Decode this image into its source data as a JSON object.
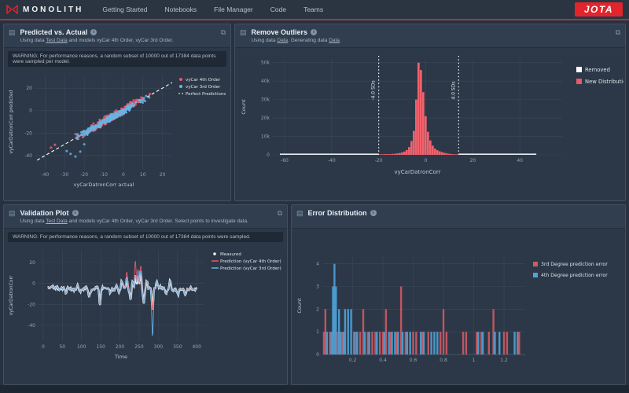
{
  "colors": {
    "accent_red": "#e2242c",
    "series_red": "#e8596a",
    "histogram_red": "#f4626d",
    "series_blue": "#67b4e6",
    "error_red": "#cf5a64",
    "error_blue": "#4fa3d8",
    "measured_white": "#f2f5f8",
    "grid": "#3a4859",
    "tick_text": "#94a2b1"
  },
  "icons": {
    "panel_handle_glyph": "▤",
    "expand_glyph": "⧉",
    "info_glyph": "i"
  },
  "nav": {
    "brand": "MONOLITH",
    "items": [
      {
        "label": "Getting Started"
      },
      {
        "label": "Notebooks"
      },
      {
        "label": "File Manager"
      },
      {
        "label": "Code"
      },
      {
        "label": "Teams"
      }
    ],
    "jota_label": "JOTA"
  },
  "panels": {
    "predicted_vs_actual": {
      "title": "Predicted vs. Actual",
      "subtitle_parts": [
        {
          "text": "Using data "
        },
        {
          "text": "Test Data",
          "link": true
        },
        {
          "text": " and models vyCar 4th Order, vyCar 3rd Order."
        }
      ],
      "warning": "WARNING: For performance reasons, a random subset of 10000 out of 17384 data points were sampled per model."
    },
    "remove_outliers": {
      "title": "Remove Outliers",
      "subtitle_parts": [
        {
          "text": "Using data "
        },
        {
          "text": "Data",
          "link": true
        },
        {
          "text": ". Generating data "
        },
        {
          "text": "Data",
          "link": true
        },
        {
          "text": "."
        }
      ]
    },
    "validation_plot": {
      "title": "Validation Plot",
      "subtitle_parts": [
        {
          "text": "Using data "
        },
        {
          "text": "Test Data",
          "link": true
        },
        {
          "text": " and models vyCar 4th Order, vyCar 3rd Order. Select points to investigate data."
        }
      ],
      "warning": "WARNING: For performance reasons, a random subset of 10000 out of 17384 data points were sampled."
    },
    "error_distribution": {
      "title": "Error Distribution"
    }
  },
  "chart_data": [
    {
      "id": "predicted-vs-actual",
      "type": "scatter",
      "xlabel": "vyCarDatronCorr actual",
      "ylabel": "vyCarDatronCorr predicted",
      "xlim": [
        -45,
        25
      ],
      "ylim": [
        -52,
        32
      ],
      "xticks": [
        -40,
        -30,
        -20,
        -10,
        0,
        10,
        20
      ],
      "yticks": [
        -40,
        -20,
        0,
        20
      ],
      "grid": true,
      "legend_position": "right",
      "series": [
        {
          "name": "vyCar 4th Order",
          "color": "#e8596a",
          "n_points": 240,
          "relationship": "y ≈ x, noise sd ≈ 2.8, x mostly -30..12",
          "outliers": [
            [
              -35,
              -30.5
            ],
            [
              -37,
              -33
            ]
          ]
        },
        {
          "name": "vyCar 3rd Order",
          "color": "#67b4e6",
          "n_points": 240,
          "relationship": "y ≈ x, noise sd ≈ 2.2, x mostly -25..12",
          "outliers": [
            [
              -27,
              -38.5
            ],
            [
              -24.5,
              -41
            ],
            [
              -29,
              -36
            ],
            [
              -22,
              -36.5
            ],
            [
              -20,
              -30
            ]
          ]
        }
      ],
      "reference_line": {
        "name": "Perfect Predictions",
        "equation": "y = x",
        "style": "dashed",
        "color": "#ffffff"
      }
    },
    {
      "id": "remove-outliers",
      "type": "bar",
      "xlabel": "vyCarDatronCorr",
      "ylabel": "Count",
      "xlim": [
        -65,
        58
      ],
      "ylim": [
        0,
        52000
      ],
      "xticks": [
        -60,
        -40,
        -20,
        0,
        20,
        40
      ],
      "yticks": [
        0,
        10000,
        20000,
        30000,
        40000,
        50000
      ],
      "ytick_labels": [
        "0",
        "10k",
        "20k",
        "30k",
        "40k",
        "50k"
      ],
      "bar_color": "#f4626d",
      "bins": [
        [
          -19,
          300
        ],
        [
          -18,
          300
        ],
        [
          -17,
          400
        ],
        [
          -16,
          350
        ],
        [
          -15,
          400
        ],
        [
          -14,
          500
        ],
        [
          -13,
          600
        ],
        [
          -12,
          800
        ],
        [
          -11,
          1000
        ],
        [
          -10,
          1300
        ],
        [
          -9,
          1800
        ],
        [
          -8,
          2600
        ],
        [
          -7,
          4200
        ],
        [
          -6,
          7500
        ],
        [
          -5,
          13000
        ],
        [
          -4,
          30000
        ],
        [
          -3,
          50000
        ],
        [
          -2,
          46000
        ],
        [
          -1,
          34000
        ],
        [
          0,
          21000
        ],
        [
          1,
          12500
        ],
        [
          2,
          7800
        ],
        [
          3,
          5000
        ],
        [
          4,
          3400
        ],
        [
          5,
          2500
        ],
        [
          6,
          1900
        ],
        [
          7,
          1500
        ],
        [
          8,
          1100
        ],
        [
          9,
          800
        ],
        [
          10,
          600
        ],
        [
          11,
          450
        ],
        [
          12,
          350
        ],
        [
          13,
          280
        ],
        [
          14,
          220
        ]
      ],
      "removed_tail_ranges": [
        [
          -62,
          -20
        ],
        [
          14,
          47
        ]
      ],
      "threshold_lines": [
        {
          "x": -20,
          "label": "-4.0 SDs"
        },
        {
          "x": 14,
          "label": "4.0 SDs"
        }
      ],
      "legend": [
        {
          "label": "Removed",
          "color": "#ffffff"
        },
        {
          "label": "New Distribution",
          "color": "#e8596a"
        }
      ]
    },
    {
      "id": "validation-plot",
      "type": "line",
      "xlabel": "Time",
      "ylabel": "vyCarDatronCorr",
      "xlim": [
        -12,
        418
      ],
      "ylim": [
        -55,
        32
      ],
      "xticks": [
        0,
        50,
        100,
        150,
        200,
        250,
        300,
        350,
        400
      ],
      "yticks": [
        -40,
        -20,
        0,
        20
      ],
      "x_start": 12,
      "x_end": 400,
      "n_points": 300,
      "baseline": -5,
      "noise_amplitude": 5,
      "series": [
        {
          "name": "Measured",
          "color": "#f2f5f8",
          "style": "markers+line",
          "width": 2.4
        },
        {
          "name": "Prediction (vyCar 4th Order)",
          "color": "#e8596a",
          "width": 0.9
        },
        {
          "name": "Prediction (vyCar 3rd Order)",
          "color": "#67b4e6",
          "width": 0.9
        }
      ],
      "shared_spikes": [
        [
          60,
          -6
        ],
        [
          90,
          5
        ],
        [
          120,
          -5
        ],
        [
          148,
          -14
        ],
        [
          175,
          -6
        ],
        [
          205,
          8
        ],
        [
          218,
          12
        ],
        [
          228,
          -10
        ],
        [
          233,
          8
        ],
        [
          240,
          16
        ],
        [
          247,
          14
        ],
        [
          254,
          18
        ],
        [
          262,
          -12
        ],
        [
          270,
          9
        ],
        [
          285,
          -22
        ],
        [
          296,
          6
        ],
        [
          320,
          -6
        ],
        [
          330,
          6
        ],
        [
          352,
          -5
        ],
        [
          370,
          -6
        ],
        [
          385,
          4
        ]
      ],
      "extra_spikes": [
        [],
        [
          [
            240,
            14
          ],
          [
            218,
            6
          ],
          [
            255,
            6
          ]
        ],
        [
          [
            285,
            -26
          ],
          [
            247,
            6
          ]
        ]
      ]
    },
    {
      "id": "error-distribution",
      "type": "bar",
      "xlabel": "",
      "ylabel": "Count",
      "xlim": [
        0,
        1.34
      ],
      "ylim": [
        0,
        4.3
      ],
      "xticks": [
        0.2,
        0.4,
        0.6,
        0.8,
        1,
        1.2
      ],
      "yticks": [
        0,
        1,
        2,
        3,
        4
      ],
      "series": [
        {
          "name": "3rd Degree prediction error",
          "color": "#cf5a64"
        },
        {
          "name": "4th Degree prediction error",
          "color": "#4fa3d8"
        }
      ],
      "bars": [
        {
          "x": 0.01,
          "series": 0,
          "count": 1
        },
        {
          "x": 0.02,
          "series": 0,
          "count": 2
        },
        {
          "x": 0.03,
          "series": 1,
          "count": 1
        },
        {
          "x": 0.05,
          "series": 0,
          "count": 1
        },
        {
          "x": 0.06,
          "series": 1,
          "count": 1
        },
        {
          "x": 0.07,
          "series": 1,
          "count": 3
        },
        {
          "x": 0.08,
          "series": 1,
          "count": 4
        },
        {
          "x": 0.09,
          "series": 1,
          "count": 3
        },
        {
          "x": 0.1,
          "series": 0,
          "count": 1
        },
        {
          "x": 0.11,
          "series": 1,
          "count": 2
        },
        {
          "x": 0.12,
          "series": 1,
          "count": 1
        },
        {
          "x": 0.13,
          "series": 0,
          "count": 1
        },
        {
          "x": 0.14,
          "series": 1,
          "count": 1
        },
        {
          "x": 0.15,
          "series": 1,
          "count": 2
        },
        {
          "x": 0.17,
          "series": 1,
          "count": 2
        },
        {
          "x": 0.19,
          "series": 1,
          "count": 2
        },
        {
          "x": 0.21,
          "series": 1,
          "count": 1
        },
        {
          "x": 0.22,
          "series": 0,
          "count": 1
        },
        {
          "x": 0.23,
          "series": 1,
          "count": 1
        },
        {
          "x": 0.25,
          "series": 0,
          "count": 1
        },
        {
          "x": 0.27,
          "series": 0,
          "count": 2
        },
        {
          "x": 0.28,
          "series": 1,
          "count": 1
        },
        {
          "x": 0.3,
          "series": 0,
          "count": 1
        },
        {
          "x": 0.31,
          "series": 1,
          "count": 1
        },
        {
          "x": 0.33,
          "series": 0,
          "count": 1
        },
        {
          "x": 0.35,
          "series": 0,
          "count": 1
        },
        {
          "x": 0.36,
          "series": 1,
          "count": 1
        },
        {
          "x": 0.38,
          "series": 0,
          "count": 1
        },
        {
          "x": 0.4,
          "series": 0,
          "count": 1
        },
        {
          "x": 0.41,
          "series": 1,
          "count": 1
        },
        {
          "x": 0.42,
          "series": 0,
          "count": 2
        },
        {
          "x": 0.44,
          "series": 1,
          "count": 1
        },
        {
          "x": 0.45,
          "series": 0,
          "count": 1
        },
        {
          "x": 0.46,
          "series": 1,
          "count": 1
        },
        {
          "x": 0.48,
          "series": 1,
          "count": 1
        },
        {
          "x": 0.49,
          "series": 0,
          "count": 1
        },
        {
          "x": 0.5,
          "series": 1,
          "count": 1
        },
        {
          "x": 0.52,
          "series": 0,
          "count": 3
        },
        {
          "x": 0.53,
          "series": 1,
          "count": 1
        },
        {
          "x": 0.55,
          "series": 0,
          "count": 1
        },
        {
          "x": 0.56,
          "series": 1,
          "count": 1
        },
        {
          "x": 0.58,
          "series": 1,
          "count": 1
        },
        {
          "x": 0.6,
          "series": 0,
          "count": 1
        },
        {
          "x": 0.62,
          "series": 0,
          "count": 1
        },
        {
          "x": 0.65,
          "series": 1,
          "count": 1
        },
        {
          "x": 0.66,
          "series": 0,
          "count": 1
        },
        {
          "x": 0.67,
          "series": 1,
          "count": 1
        },
        {
          "x": 0.7,
          "series": 0,
          "count": 1
        },
        {
          "x": 0.72,
          "series": 1,
          "count": 1
        },
        {
          "x": 0.74,
          "series": 1,
          "count": 1
        },
        {
          "x": 0.76,
          "series": 1,
          "count": 1
        },
        {
          "x": 0.78,
          "series": 0,
          "count": 1
        },
        {
          "x": 0.8,
          "series": 0,
          "count": 2
        },
        {
          "x": 0.82,
          "series": 0,
          "count": 1
        },
        {
          "x": 0.93,
          "series": 0,
          "count": 1
        },
        {
          "x": 0.95,
          "series": 0,
          "count": 1
        },
        {
          "x": 1.02,
          "series": 0,
          "count": 1
        },
        {
          "x": 1.03,
          "series": 1,
          "count": 1
        },
        {
          "x": 1.05,
          "series": 0,
          "count": 1
        },
        {
          "x": 1.06,
          "series": 1,
          "count": 1
        },
        {
          "x": 1.1,
          "series": 0,
          "count": 1
        },
        {
          "x": 1.13,
          "series": 0,
          "count": 2
        },
        {
          "x": 1.14,
          "series": 1,
          "count": 1
        },
        {
          "x": 1.17,
          "series": 1,
          "count": 1
        },
        {
          "x": 1.2,
          "series": 0,
          "count": 1
        },
        {
          "x": 1.22,
          "series": 0,
          "count": 1
        },
        {
          "x": 1.27,
          "series": 1,
          "count": 1
        },
        {
          "x": 1.29,
          "series": 1,
          "count": 1
        },
        {
          "x": 1.3,
          "series": 0,
          "count": 1
        }
      ]
    }
  ]
}
